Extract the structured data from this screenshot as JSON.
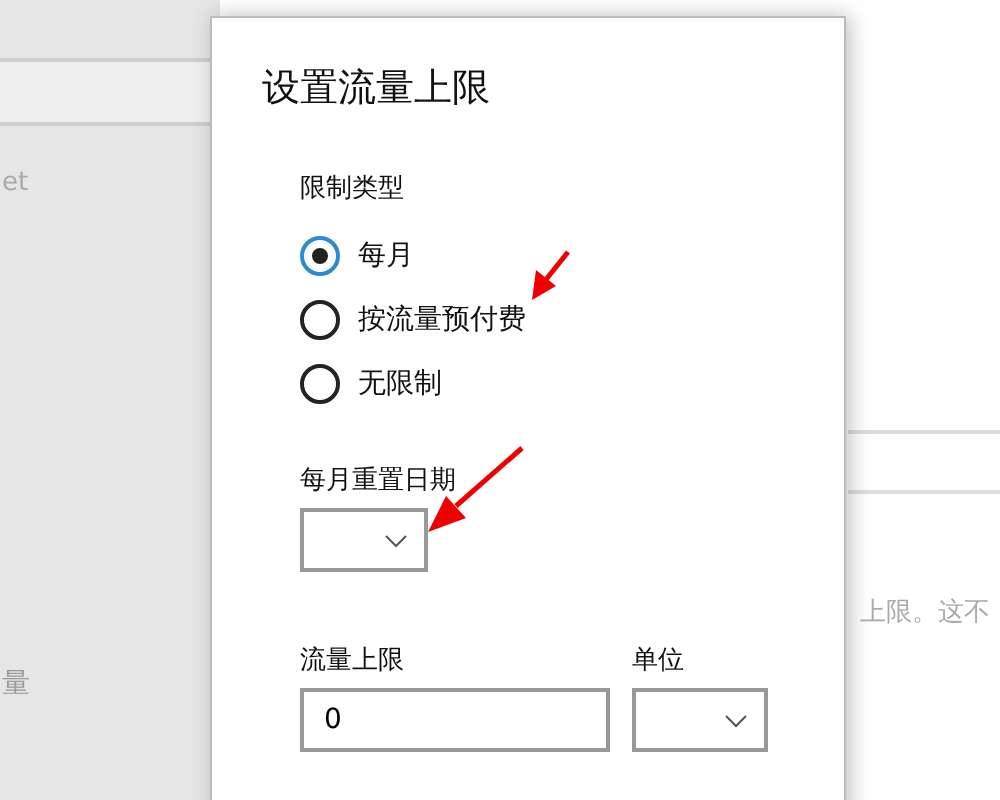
{
  "background": {
    "left_text_top": "et",
    "left_text_bottom": "量",
    "right_text": "上限。这不"
  },
  "dialog": {
    "title": "设置流量上限",
    "limit_type": {
      "label": "限制类型",
      "options": [
        {
          "label": "每月",
          "selected": true
        },
        {
          "label": "按流量预付费",
          "selected": false
        },
        {
          "label": "无限制",
          "selected": false
        }
      ]
    },
    "reset_date": {
      "label": "每月重置日期"
    },
    "limit": {
      "label": "流量上限",
      "value": "0"
    },
    "unit": {
      "label": "单位"
    }
  }
}
